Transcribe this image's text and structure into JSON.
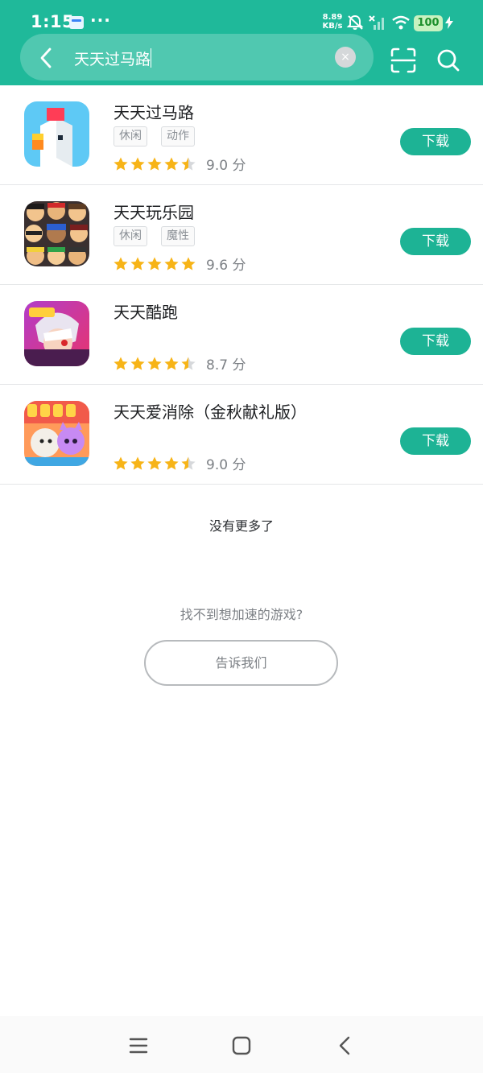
{
  "status_bar": {
    "time": "1:15",
    "more": "···",
    "speed_value": "8.89",
    "speed_unit": "KB/s",
    "battery": "100"
  },
  "search": {
    "query": "天天过马路",
    "clear_symbol": "×"
  },
  "results": [
    {
      "title": "天天过马路",
      "tags": [
        "休闲",
        "动作"
      ],
      "rating": 4.5,
      "score": "9.0 分",
      "download_label": "下载",
      "icon": "crossy-road-chicken-icon"
    },
    {
      "title": "天天玩乐园",
      "tags": [
        "休闲",
        "魔性"
      ],
      "rating": 5,
      "score": "9.6 分",
      "download_label": "下载",
      "icon": "crowd-characters-icon"
    },
    {
      "title": "天天酷跑",
      "tags": [],
      "rating": 4.5,
      "score": "8.7 分",
      "download_label": "下载",
      "icon": "parkour-hero-icon"
    },
    {
      "title": "天天爱消除（金秋献礼版）",
      "tags": [],
      "rating": 4.5,
      "score": "9.0 分",
      "download_label": "下载",
      "icon": "sheep-and-cat-2025-icon"
    }
  ],
  "footer": {
    "no_more": "没有更多了",
    "cant_find": "找不到想加速的游戏?",
    "tell_us": "告诉我们"
  },
  "colors": {
    "header": "#1fb99a",
    "download": "#1db395",
    "star": "#f7b417"
  }
}
